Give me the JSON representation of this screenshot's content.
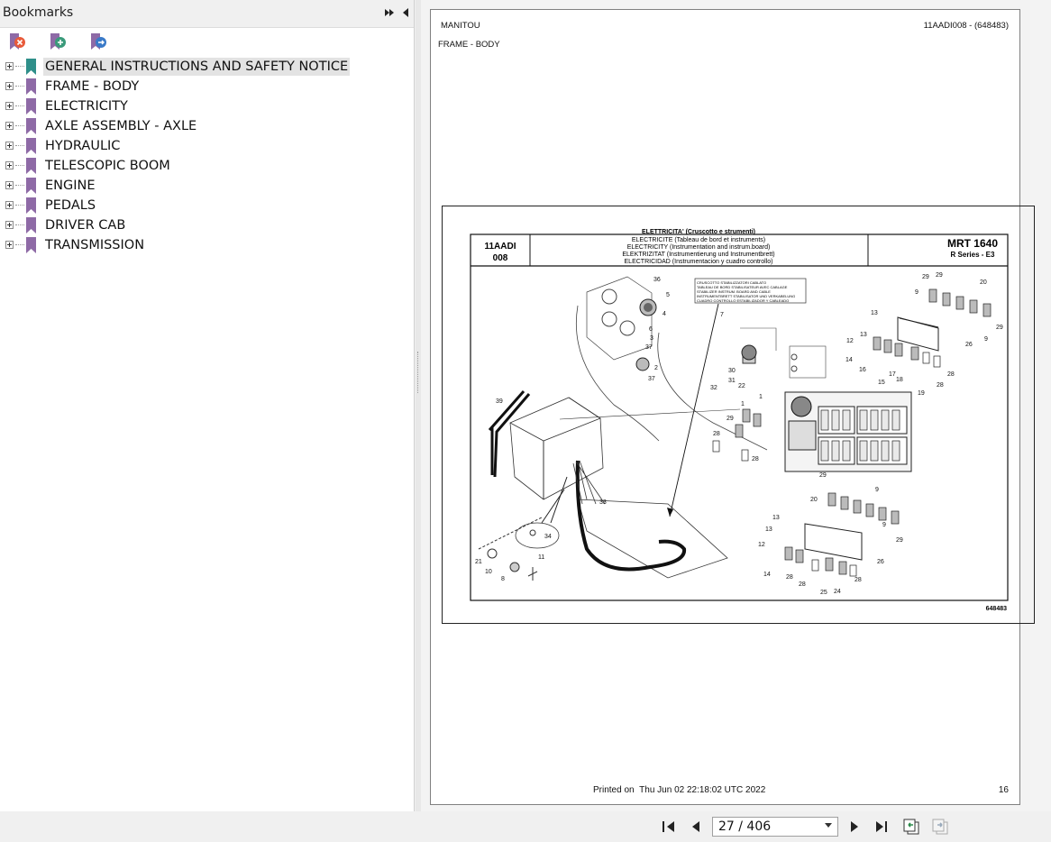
{
  "sidebar": {
    "title": "Bookmarks",
    "items": [
      {
        "label": "GENERAL INSTRUCTIONS AND SAFETY NOTICE"
      },
      {
        "label": "FRAME - BODY"
      },
      {
        "label": "ELECTRICITY"
      },
      {
        "label": "AXLE ASSEMBLY - AXLE"
      },
      {
        "label": "HYDRAULIC"
      },
      {
        "label": "TELESCOPIC BOOM"
      },
      {
        "label": "ENGINE"
      },
      {
        "label": "PEDALS"
      },
      {
        "label": "DRIVER CAB"
      },
      {
        "label": "TRANSMISSION"
      }
    ]
  },
  "page": {
    "brand": "MANITOU",
    "doc_ref": "11AADI008 - (648483)",
    "section": "FRAME - BODY",
    "drawing": {
      "code_line1": "11AADI",
      "code_line2": "008",
      "title_lines": [
        "ELETTRICITA' (Cruscotto e strumenti)",
        "ELECTRICITE (Tableau de bord et instruments)",
        "ELECTRICITY (Instrumentation and instrum.board)",
        "ELEKTRIZITAT (Instrumentierung und Instrumentbrett)",
        "ELECTRICIDAD (Instrumentacion y cuadro controllo)"
      ],
      "model": "MRT 1640",
      "series": "R Series - E3",
      "label_box_lines": [
        "CRUSCOTTO STABILIZZATORI CABLATO",
        "TABLEAU DE BORD STABILISATEUR AVEC CABLAGE",
        "STABILIZER INSTRUM. BOARD AND CABLE",
        "INSTRUMENTBRETT STABILISATOR UND VERKABELUNG",
        "CUADRO CONTROLLO ESTABILIZADOR Y CABLEADO"
      ],
      "number": "648483",
      "callouts": [
        "36",
        "5",
        "4",
        "6",
        "3",
        "37",
        "2",
        "37",
        "7",
        "39",
        "30",
        "31",
        "22",
        "32",
        "1",
        "1",
        "29",
        "28",
        "28",
        "33",
        "34",
        "21",
        "10",
        "8",
        "11",
        "12",
        "13",
        "13",
        "14",
        "16",
        "17",
        "15",
        "18",
        "19",
        "28",
        "28",
        "29",
        "29",
        "9",
        "20",
        "29",
        "9",
        "26",
        "29",
        "9",
        "20",
        "9",
        "29",
        "13",
        "13",
        "12",
        "14",
        "28",
        "28",
        "25",
        "24",
        "28",
        "26"
      ]
    },
    "printed_label": "Printed on",
    "printed_date": "Thu Jun 02 22:18:02 UTC 2022",
    "page_number": "16"
  },
  "nav": {
    "page_field": "27 / 406"
  },
  "colors": {
    "bookmark_flag": "#8e6aa6",
    "bookmark_flag_active": "#2f8f8a",
    "accent_tool": "#7a5aa0"
  }
}
